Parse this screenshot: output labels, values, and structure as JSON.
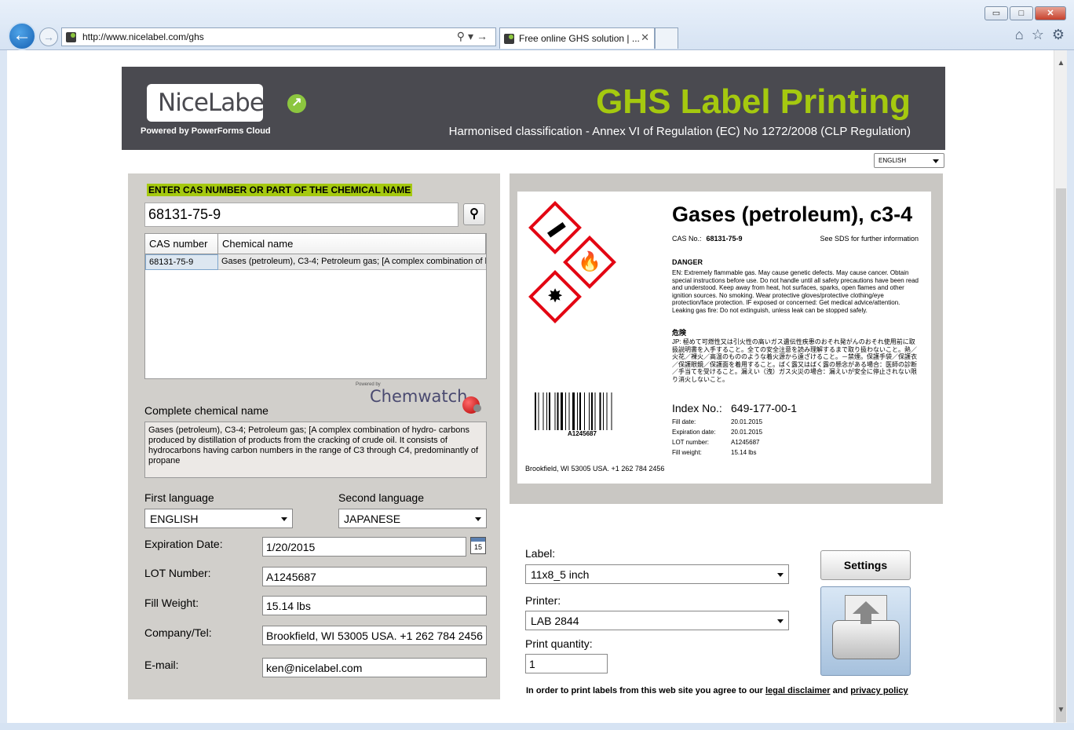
{
  "browser": {
    "url": "http://www.nicelabel.com/ghs",
    "tab_title": "Free online GHS solution | ...",
    "win_min": "▭",
    "win_max": "□",
    "win_close": "✕"
  },
  "header": {
    "logo_text": "NiceLabel",
    "powered_by": "Powered by PowerForms Cloud",
    "title": "GHS Label Printing",
    "subtitle": "Harmonised classification - Annex VI of Regulation (EC) No 1272/2008 (CLP Regulation)"
  },
  "language_select": "ENGLISH",
  "search": {
    "label": "ENTER CAS NUMBER OR PART OF THE CHEMICAL NAME",
    "value": "68131-75-9"
  },
  "results": {
    "columns": [
      "CAS number",
      "Chemical name"
    ],
    "rows": [
      {
        "cas": "68131-75-9",
        "name": "Gases (petroleum), C3-4; Petroleum gas; [A complex combination of h"
      }
    ]
  },
  "chemwatch": {
    "powered": "Powered by",
    "name": "Chemwatch"
  },
  "complete_name": {
    "label": "Complete chemical name",
    "value": "Gases (petroleum), C3-4; Petroleum gas; [A complex combination of hydro- carbons produced by distillation of products from the cracking of crude oil. It consists of hydrocarbons having carbon numbers in the range of C3 through C4, predominantly of propane"
  },
  "form": {
    "first_language_label": "First language",
    "first_language": "ENGLISH",
    "second_language_label": "Second language",
    "second_language": "JAPANESE",
    "expiration_label": "Expiration Date:",
    "expiration": "1/20/2015",
    "calendar_day": "15",
    "lot_label": "LOT Number:",
    "lot": "A1245687",
    "fill_label": "Fill Weight:",
    "fill": "15.14 lbs",
    "company_label": "Company/Tel:",
    "company": "Brookfield, WI 53005 USA. +1 262 784 2456",
    "email_label": "E-mail:",
    "email": "ken@nicelabel.com"
  },
  "label_preview": {
    "title": "Gases (petroleum), c3-4",
    "cas_label": "CAS No.:",
    "cas": "68131-75-9",
    "sds": "See SDS for further information",
    "signal_en": "DANGER",
    "text_en": "EN: Extremely flammable gas. May cause genetic defects. May cause cancer. Obtain special instructions before use. Do not handle until all safety precautions have been read and understood. Keep away from heat, hot surfaces, sparks, open flames and other ignition sources. No smoking. Wear protective gloves/protective clothing/eye protection/face protection. IF exposed or concerned: Get medical advice/attention. Leaking gas fire: Do not extinguish, unless leak can be stopped safely.",
    "signal_jp": "危険",
    "text_jp": "JP: 極めて可燃性又は引火性の高いガス遺伝性疾患のおそれ発がんのおそれ使用前に取扱説明書を入手すること。全ての安全注意を読み理解するまで取り扱わないこと。熱／火花／裸火／高温のもののような着火源から遠ざけること。－禁煙。保護手袋／保護衣／保護眼鏡／保護面を着用すること。ばく露又はばく露の懸念がある場合：医師の診断／手当てを受けること。漏えい（洩）ガス火災の場合：漏えいが安全に停止されない限り消火しないこと。",
    "barcode_value": "A1245687",
    "index_label": "Index No.:",
    "index": "649-177-00-1",
    "fill_date_label": "Fill date:",
    "fill_date": "20.01.2015",
    "expiration_label": "Expiration date:",
    "expiration": "20.01.2015",
    "lot_label": "LOT number:",
    "lot": "A1245687",
    "fill_weight_label": "Fill weight:",
    "fill_weight": "15.14 lbs",
    "company": "Brookfield, WI 53005 USA. +1 262 784 2456"
  },
  "print": {
    "label_label": "Label:",
    "label_value": "11x8_5 inch",
    "printer_label": "Printer:",
    "printer_value": "LAB 2844",
    "quantity_label": "Print quantity:",
    "quantity": "1",
    "settings": "Settings",
    "disclaimer_prefix": "In order to print labels from this web site you agree to our",
    "legal_link": "legal disclaimer",
    "and": "and",
    "privacy_link": "privacy policy"
  }
}
